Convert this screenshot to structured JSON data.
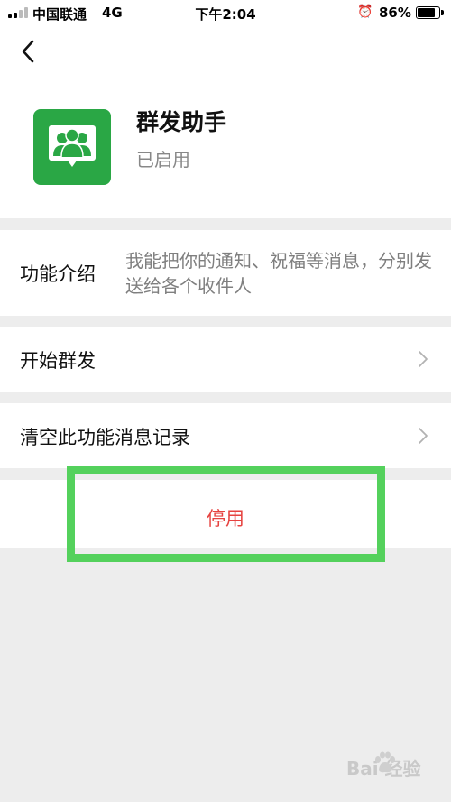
{
  "status_bar": {
    "carrier": "中国联通",
    "network": "4G",
    "time": "下午2:04",
    "battery": "86%",
    "battery_level": 0.86,
    "icons": [
      "signal-icon",
      "alarm-icon",
      "battery-icon"
    ]
  },
  "header": {
    "back_icon": "chevron-left-icon",
    "app_icon": "group-broadcast-icon",
    "app_icon_color": "#2aa745",
    "title": "群发助手",
    "status": "已启用"
  },
  "intro": {
    "label": "功能介绍",
    "description": "我能把你的通知、祝福等消息，分别发送给各个收件人"
  },
  "menu": {
    "start": {
      "label": "开始群发",
      "icon": "chevron-right-icon"
    },
    "clear": {
      "label": "清空此功能消息记录",
      "icon": "chevron-right-icon"
    }
  },
  "disable": {
    "label": "停用",
    "color": "#e64340",
    "highlight_color": "#54d15c"
  },
  "watermark": {
    "text": "Bai 经验"
  }
}
